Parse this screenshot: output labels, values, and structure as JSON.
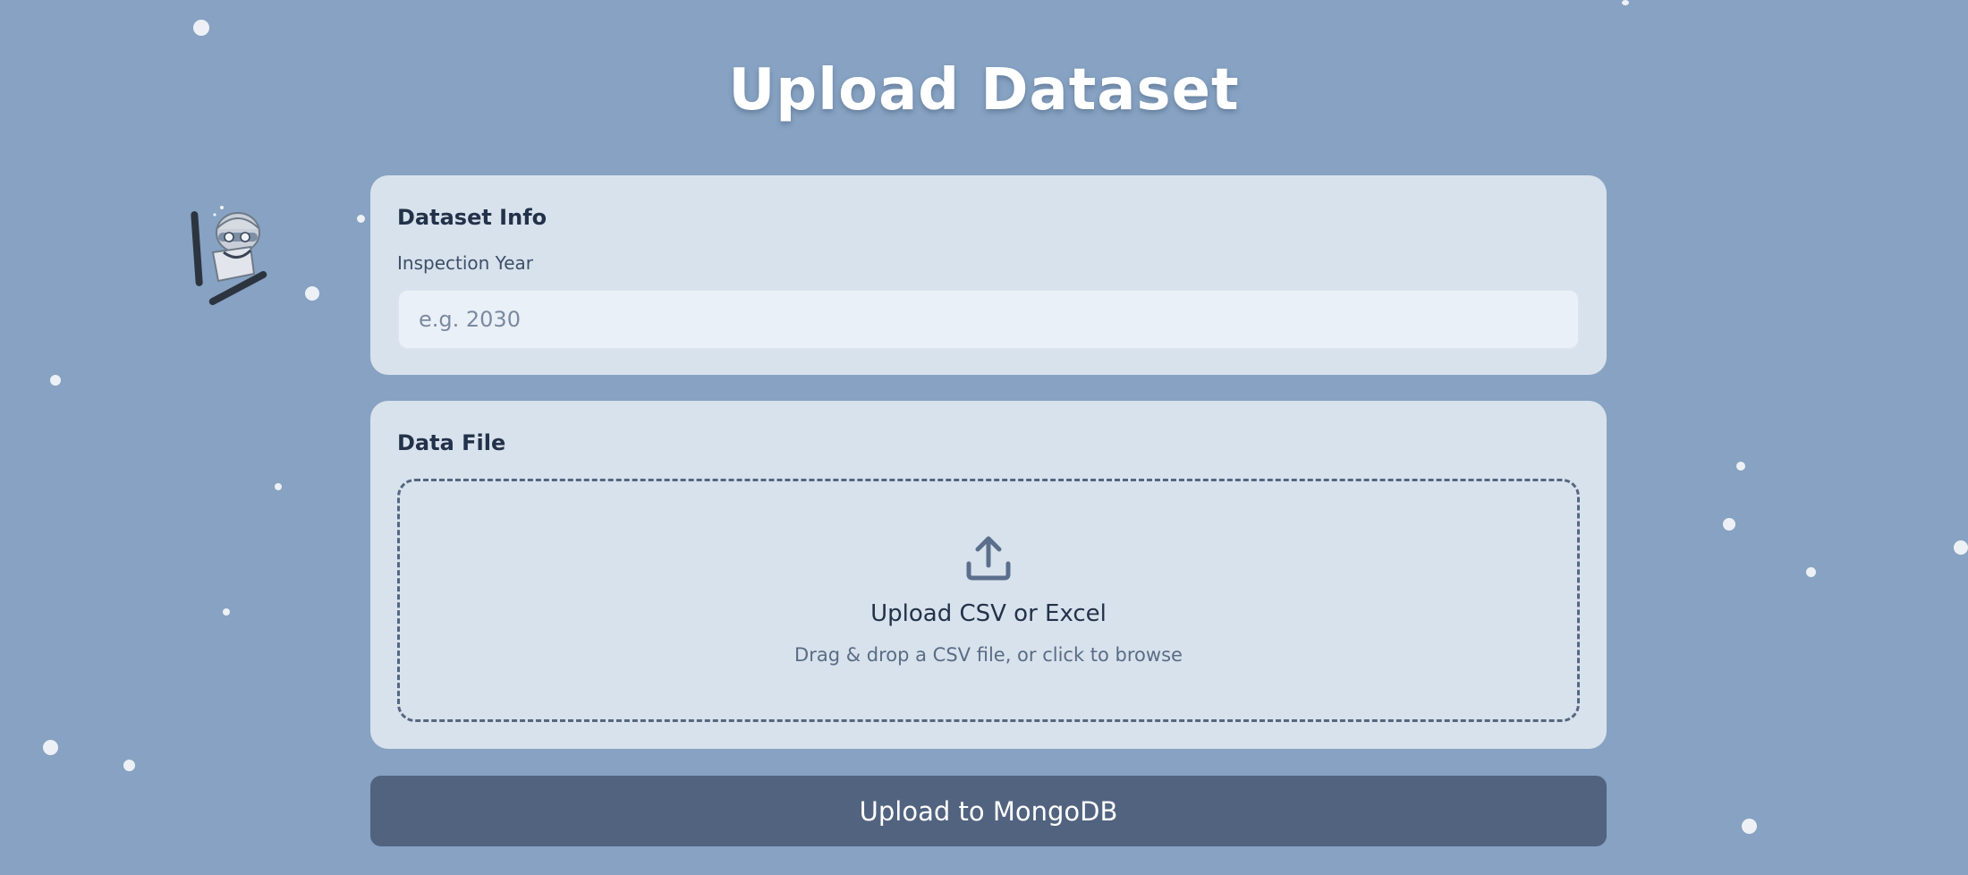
{
  "page": {
    "title": "Upload Dataset"
  },
  "dataset_info": {
    "heading": "Dataset Info",
    "year_label": "Inspection Year",
    "year_value": "",
    "year_placeholder": "e.g. 2030"
  },
  "data_file": {
    "heading": "Data File",
    "icon": "upload-icon",
    "title": "Upload CSV or Excel",
    "subtitle": "Drag & drop a CSV file, or click to browse"
  },
  "actions": {
    "submit_label": "Upload to MongoDB"
  },
  "colors": {
    "background": "#87a2c2",
    "card": "#d8e2ec",
    "button": "#51637f"
  }
}
